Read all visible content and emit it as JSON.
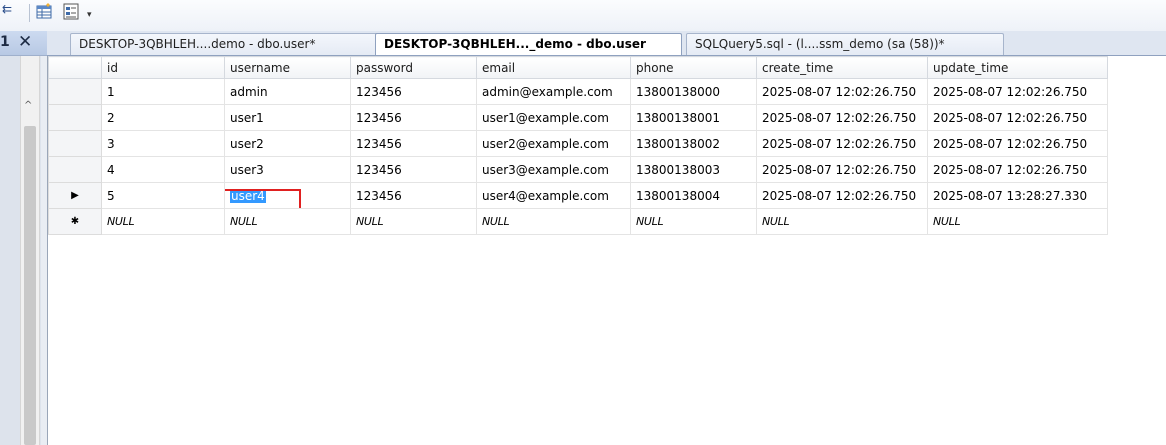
{
  "toolbar": {
    "glyph_left": "⇇",
    "icons": [
      "table-add-icon",
      "properties-icon"
    ],
    "dropdown_glyph": "▾"
  },
  "left_panel": {
    "header_glyph": "1",
    "close_glyph": "✕",
    "scroll_up_glyph": "^"
  },
  "tabs": [
    {
      "label": "DESKTOP-3QBHLEH....demo - dbo.user*",
      "active": false
    },
    {
      "label": "DESKTOP-3QBHLEH..._demo - dbo.user",
      "active": true
    },
    {
      "label": "SQLQuery5.sql - (l....ssm_demo (sa (58))*",
      "active": false
    }
  ],
  "grid": {
    "columns": [
      "id",
      "username",
      "password",
      "email",
      "phone",
      "create_time",
      "update_time"
    ],
    "rows": [
      [
        "1",
        "admin",
        "123456",
        "admin@example.com",
        "13800138000",
        "2025-08-07 12:02:26.750",
        "2025-08-07 12:02:26.750"
      ],
      [
        "2",
        "user1",
        "123456",
        "user1@example.com",
        "13800138001",
        "2025-08-07 12:02:26.750",
        "2025-08-07 12:02:26.750"
      ],
      [
        "3",
        "user2",
        "123456",
        "user2@example.com",
        "13800138002",
        "2025-08-07 12:02:26.750",
        "2025-08-07 12:02:26.750"
      ],
      [
        "4",
        "user3",
        "123456",
        "user3@example.com",
        "13800138003",
        "2025-08-07 12:02:26.750",
        "2025-08-07 12:02:26.750"
      ],
      [
        "5",
        "user4",
        "123456",
        "user4@example.com",
        "13800138004",
        "2025-08-07 12:02:26.750",
        "2025-08-07 13:28:27.330"
      ]
    ],
    "current_row_indicator": "▶",
    "new_row_indicator": "✱",
    "null_text": "NULL",
    "selected_row_index": 4,
    "selected_col_index": 1
  },
  "colors": {
    "selection": "#3399ff",
    "highlight_box": "#e02020",
    "tab_active_bg": "#ffffff",
    "tabstrip_bg": "#dfe6f1"
  }
}
